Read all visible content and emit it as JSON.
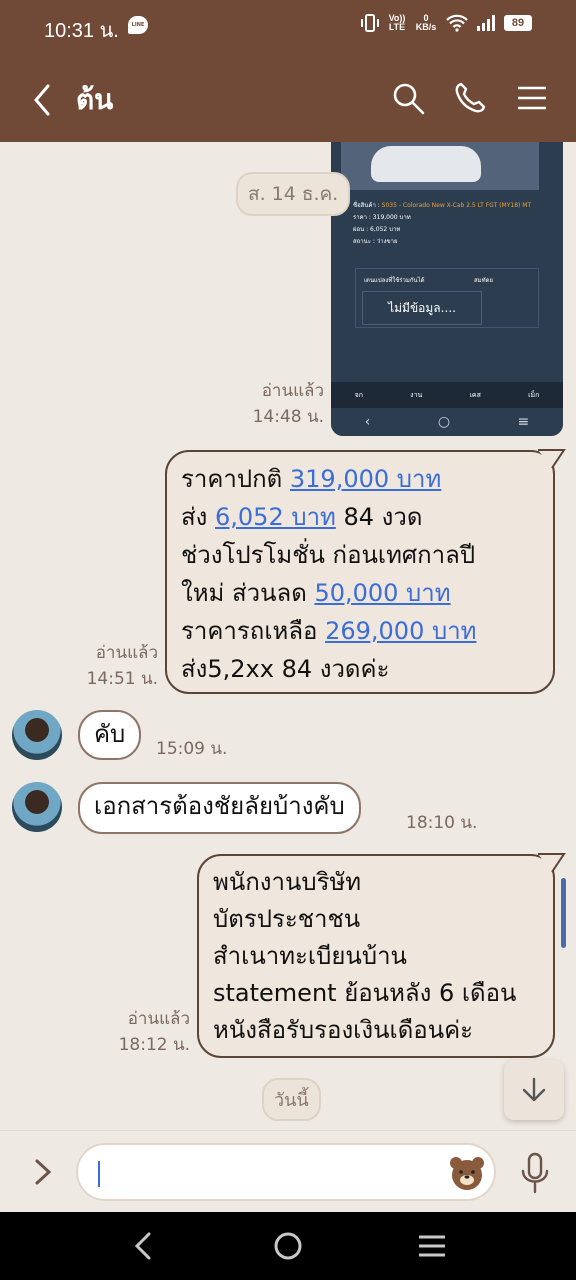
{
  "status_bar": {
    "time": "10:31 น.",
    "line_badge": "LINE",
    "volte": "Vo)) LTE",
    "speed": "0 KB/s",
    "battery": "89"
  },
  "header": {
    "title": "ต้น",
    "back_icon": "chevron-left-icon",
    "search_icon": "search-icon",
    "call_icon": "phone-icon",
    "menu_icon": "hamburger-menu-icon"
  },
  "chat": {
    "date_sat": "ส. 14 ธ.ค.",
    "screenshot": {
      "product_label": "ชื่อสินค้า : ",
      "product_name": "S035 - Colorado New X-Cab 2.5 LT FGT (MY18) MT",
      "price": "ราคา : 319,000 บาท",
      "installment": "ผ่อน : 6,052 บาท",
      "status": "สถานะ : ว่างขาย",
      "table_col1": "เดนแปลงที่ใช้ร่วมกันได้",
      "table_col2": "สมทัดย",
      "empty": "ไม่มีข้อมูล....",
      "nav": [
        "จก",
        "งาน",
        "เคส",
        "เม็ก"
      ]
    },
    "read_1": "อ่านแล้ว",
    "time_1": "14:48 น.",
    "msg_price": {
      "l1_a": "ราคาปกติ ",
      "l1_link": "319,000 บาท",
      "l2_a": "ส่ง ",
      "l2_link": "6,052 บาท",
      "l2_b": " 84 งวด",
      "l3": "ช่วงโปรโมชั่น ก่อนเทศกาลปี",
      "l4_a": "ใหม่ ส่วนลด ",
      "l4_link": "50,000 บาท",
      "l5_a": "ราคารถเหลือ ",
      "l5_link": "269,000 บาท",
      "l6": "ส่ง5,2xx 84 งวดค่ะ"
    },
    "read_2": "อ่านแล้ว",
    "time_2": "14:51 น.",
    "msg_in_1": "คับ",
    "time_in_1": "15:09 น.",
    "msg_in_2": "เอกสารต้องชัยลัยบ้างคับ",
    "time_in_2": "18:10 น.",
    "msg_docs": [
      "พนักงานบริษัท",
      "บัตรประชาชน",
      "สำเนาทะเบียนบ้าน",
      "statement ย้อนหลัง 6 เดือน",
      "หนังสือรับรองเงินเดือนค่ะ"
    ],
    "read_3": "อ่านแล้ว",
    "time_3": "18:12 น.",
    "date_today": "วันนี้"
  },
  "input": {
    "placeholder": ""
  },
  "colors": {
    "header_bg": "#714a37",
    "chat_bg": "#efe9e3",
    "link": "#3a6dd8"
  }
}
